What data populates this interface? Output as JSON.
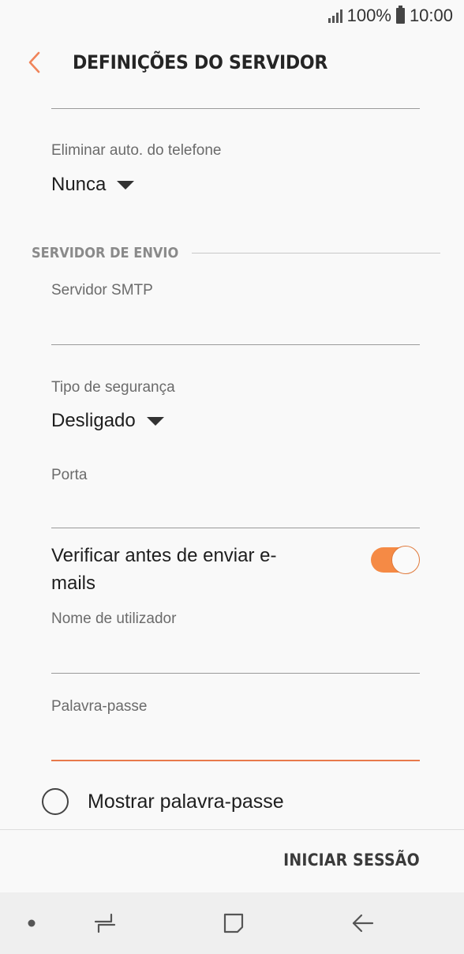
{
  "status_bar": {
    "battery_percent": "100%",
    "time": "10:00",
    "icons": [
      "signal-icon",
      "battery-icon"
    ]
  },
  "header": {
    "title": "DEFINIÇÕES DO SERVIDOR",
    "back_icon": "chevron-left-icon"
  },
  "incoming": {
    "auto_delete_label": "Eliminar auto. do telefone",
    "auto_delete_value": "Nunca"
  },
  "outgoing": {
    "section_title": "SERVIDOR DE ENVIO",
    "smtp_label": "Servidor SMTP",
    "smtp_value": "",
    "security_label": "Tipo de segurança",
    "security_value": "Desligado",
    "port_label": "Porta",
    "port_value": "",
    "verify_label": "Verificar antes de enviar e-mails",
    "verify_on": true,
    "username_label": "Nome de utilizador",
    "username_value": "",
    "password_label": "Palavra-passe",
    "password_value": "",
    "show_password_label": "Mostrar palavra-passe",
    "show_password_checked": false
  },
  "footer": {
    "signin_label": "INICIAR SESSÃO"
  },
  "nav": {
    "icons": [
      "dot-icon",
      "recent-apps-icon",
      "home-icon",
      "back-arrow-icon"
    ]
  },
  "colors": {
    "accent": "#f58a45",
    "background": "#f9f9f9",
    "nav_background": "#efefef"
  }
}
